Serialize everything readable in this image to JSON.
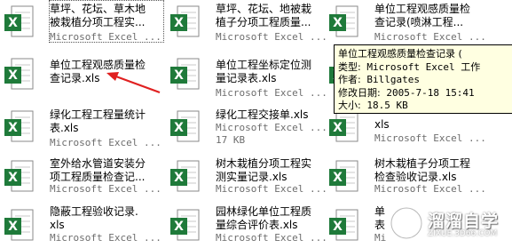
{
  "files": [
    {
      "name": "草坪、花坛、草木地\n被栽植分项工程实...",
      "type": "Microsoft Excel ..."
    },
    {
      "name": "草坪、花坛、地被栽\n植子分项工程质量...",
      "type": "Microsoft Excel ..."
    },
    {
      "name": "单位工程观感质量检\n查记录(喷淋工程...",
      "type": "Microsoft Excel ..."
    },
    {
      "name": "单位工程观感质量检\n查记录.xls",
      "type": ""
    },
    {
      "name": "单位工程坐标定位测\n量记录表.xls",
      "type": "Microsoft Excel ..."
    },
    {
      "name": "绿化工程工程量统计\n表.xls",
      "type": "Microsoft Excel ..."
    },
    {
      "name": "绿化工程交接单.xls",
      "type": "Microsoft Excel ...",
      "size": "17 KB"
    },
    {
      "name": "xls",
      "type": "Microsoft Excel ..."
    },
    {
      "name": "室外给水管道安装分\n项工程质量检查记...",
      "type": "Microsoft Excel ..."
    },
    {
      "name": "树木栽植分项工程实\n测实量记录.xls",
      "type": "Microsoft Excel ..."
    },
    {
      "name": "树木栽植子分项工程\n检查验收记录.xls",
      "type": "Microsoft Excel ..."
    },
    {
      "name": "隐蔽工程验收记录.\nxls",
      "type": "Microsoft Excel ..."
    },
    {
      "name": "园林绿化单位工程质\n量综合评价表.xls",
      "type": "Microsoft Excel ..."
    },
    {
      "name": "单\n表.",
      "type": "Mi"
    }
  ],
  "tooltip": {
    "title": "单位工程观感质量检查记录 (",
    "type_label": "类型:",
    "type_value": " Microsoft Excel 工作",
    "author_label": "作者:",
    "author_value": " Billgates",
    "modified_label": "修改日期:",
    "modified_value": " 2005-7-18 15:41",
    "size_label": "大小:",
    "size_value": " 18.5 KB"
  },
  "watermark": {
    "title": "溜溜自学",
    "sub": "ZIXUE.3D66.COM"
  },
  "colors": {
    "excel_green": "#1f7a3a",
    "arrow_red": "#e02020",
    "tooltip_bg": "#ffffe1"
  }
}
